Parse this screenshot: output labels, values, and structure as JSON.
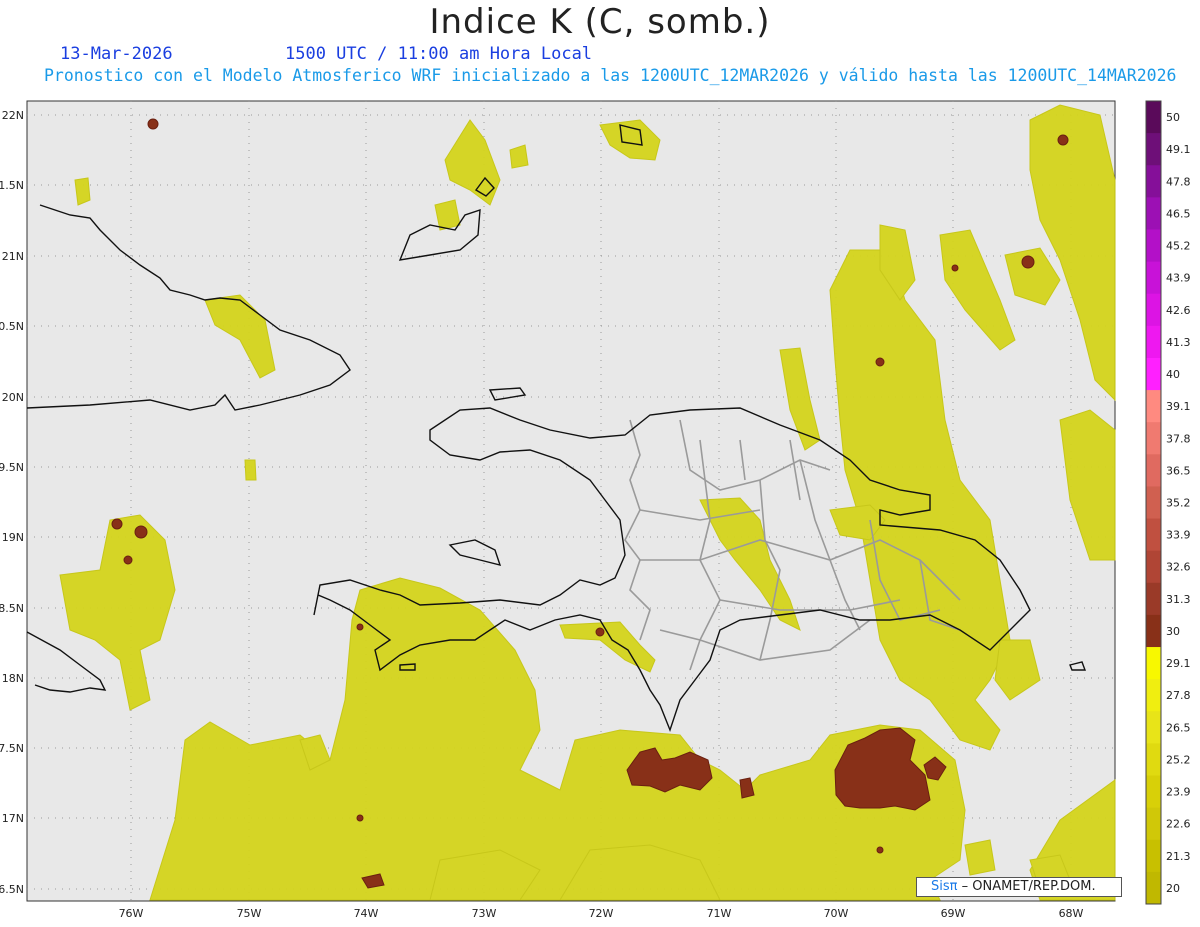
{
  "header": {
    "title": "Indice K (C, somb.)",
    "date": "13-Mar-2026",
    "time": "1500 UTC / 11:00 am Hora Local",
    "description": "Pronostico con el Modelo Atmosferico WRF inicializado a las 1200UTC_12MAR2026 y válido hasta las  1200UTC_14MAR2026"
  },
  "axes": {
    "lat_labels": [
      "22N",
      "1.5N",
      "21N",
      "0.5N",
      "20N",
      "9.5N",
      "19N",
      "8.5N",
      "18N",
      "7.5N",
      "17N",
      "6.5N"
    ],
    "lon_labels": [
      "76W",
      "75W",
      "74W",
      "73W",
      "72W",
      "71W",
      "70W",
      "69W",
      "68W"
    ]
  },
  "colorbar": {
    "levels": [
      "50",
      "49.1",
      "47.8",
      "46.5",
      "45.2",
      "43.9",
      "42.6",
      "41.3",
      "40",
      "39.1",
      "37.8",
      "36.5",
      "35.2",
      "33.9",
      "32.6",
      "31.3",
      "30",
      "29.1",
      "27.8",
      "26.5",
      "25.2",
      "23.9",
      "22.6",
      "21.3",
      "20"
    ],
    "colors": [
      "#5a0a5a",
      "#6e0f78",
      "#850f99",
      "#9c10b4",
      "#b310c8",
      "#c812d8",
      "#dc14e4",
      "#ee18f0",
      "#ff20ff",
      "#ff8a80",
      "#f07a70",
      "#e06a60",
      "#d06050",
      "#c05040",
      "#b04535",
      "#9a3a28",
      "#883018",
      "#f8f800",
      "#f0ee10",
      "#e8e418",
      "#e0da10",
      "#d8d008",
      "#d0c808",
      "#c8c000",
      "#c0b800"
    ]
  },
  "credit": {
    "brand": "Sisπ",
    "org": " – ONAMET/REP.DOM."
  },
  "colors": {
    "background": "#e8e8e8",
    "k_low": "#d8d820",
    "k_high": "#883018",
    "coast": "#111111",
    "province": "#9a9a9a"
  }
}
